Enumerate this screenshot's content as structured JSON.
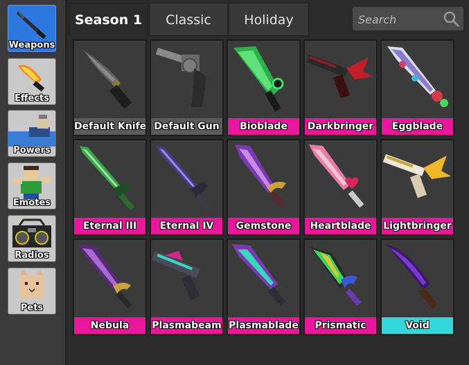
{
  "sidebar": {
    "items": [
      {
        "label": "Weapons",
        "active": true
      },
      {
        "label": "Effects"
      },
      {
        "label": "Powers"
      },
      {
        "label": "Emotes"
      },
      {
        "label": "Radios"
      },
      {
        "label": "Pets"
      }
    ]
  },
  "tabs": [
    {
      "label": "Season 1",
      "active": true
    },
    {
      "label": "Classic"
    },
    {
      "label": "Holiday"
    }
  ],
  "search": {
    "placeholder": "Search",
    "value": ""
  },
  "colors": {
    "common": "#5b5b5b",
    "godly": "#e8179b",
    "ancient": "#34d6d9",
    "active_tab": "#2f78e0"
  },
  "items": [
    {
      "name": "Default Knife",
      "rarity": "common"
    },
    {
      "name": "Default Gun",
      "rarity": "common"
    },
    {
      "name": "Bioblade",
      "rarity": "godly"
    },
    {
      "name": "Darkbringer",
      "rarity": "godly"
    },
    {
      "name": "Eggblade",
      "rarity": "godly"
    },
    {
      "name": "Eternal III",
      "rarity": "godly"
    },
    {
      "name": "Eternal IV",
      "rarity": "godly"
    },
    {
      "name": "Gemstone",
      "rarity": "godly"
    },
    {
      "name": "Heartblade",
      "rarity": "godly"
    },
    {
      "name": "Lightbringer",
      "rarity": "godly"
    },
    {
      "name": "Nebula",
      "rarity": "godly"
    },
    {
      "name": "Plasmabeam",
      "rarity": "godly"
    },
    {
      "name": "Plasmablade",
      "rarity": "godly"
    },
    {
      "name": "Prismatic",
      "rarity": "godly"
    },
    {
      "name": "Void",
      "rarity": "ancient"
    }
  ]
}
